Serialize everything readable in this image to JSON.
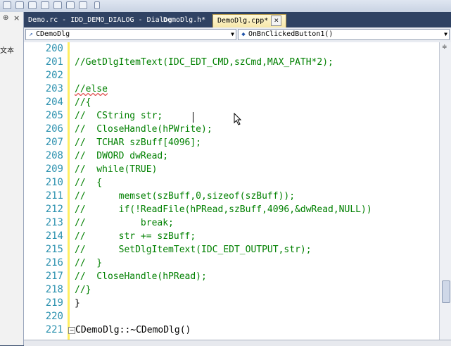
{
  "tabs": [
    {
      "label": "Demo.rc - IDD_DEMO_DIALOG - Dialog",
      "active": false
    },
    {
      "label": "DemoDlg.h*",
      "active": false
    },
    {
      "label": "DemoDlg.cpp*",
      "active": true
    }
  ],
  "left_panel": {
    "text": "文本"
  },
  "nav": {
    "class_combo": "CDemoDlg",
    "member_combo": "OnBnClickedButton1()"
  },
  "editor": {
    "lines": [
      {
        "num": "200",
        "code": ""
      },
      {
        "num": "201",
        "code": "//GetDlgItemText(IDC_EDT_CMD,szCmd,MAX_PATH*2);"
      },
      {
        "num": "202",
        "code": ""
      },
      {
        "num": "203",
        "code": "//else"
      },
      {
        "num": "204",
        "code": "//{"
      },
      {
        "num": "205",
        "code": "//  CString str;"
      },
      {
        "num": "206",
        "code": "//  CloseHandle(hPWrite);"
      },
      {
        "num": "207",
        "code": "//  TCHAR szBuff[4096];"
      },
      {
        "num": "208",
        "code": "//  DWORD dwRead;"
      },
      {
        "num": "209",
        "code": "//  while(TRUE)"
      },
      {
        "num": "210",
        "code": "//  {"
      },
      {
        "num": "211",
        "code": "//      memset(szBuff,0,sizeof(szBuff));"
      },
      {
        "num": "212",
        "code": "//      if(!ReadFile(hPRead,szBuff,4096,&dwRead,NULL))"
      },
      {
        "num": "213",
        "code": "//          break;"
      },
      {
        "num": "214",
        "code": "//      str += szBuff;"
      },
      {
        "num": "215",
        "code": "//      SetDlgItemText(IDC_EDT_OUTPUT,str);"
      },
      {
        "num": "216",
        "code": "//  }"
      },
      {
        "num": "217",
        "code": "//  CloseHandle(hPRead);"
      },
      {
        "num": "218",
        "code": "//}"
      },
      {
        "num": "219",
        "code": "}"
      },
      {
        "num": "220",
        "code": ""
      },
      {
        "num": "221",
        "code": "CDemoDlg::~CDemoDlg()"
      }
    ]
  },
  "colors": {
    "comment": "#008000",
    "code": "#000000",
    "line_number": "#2b91af",
    "change_margin": "#ffee62"
  }
}
